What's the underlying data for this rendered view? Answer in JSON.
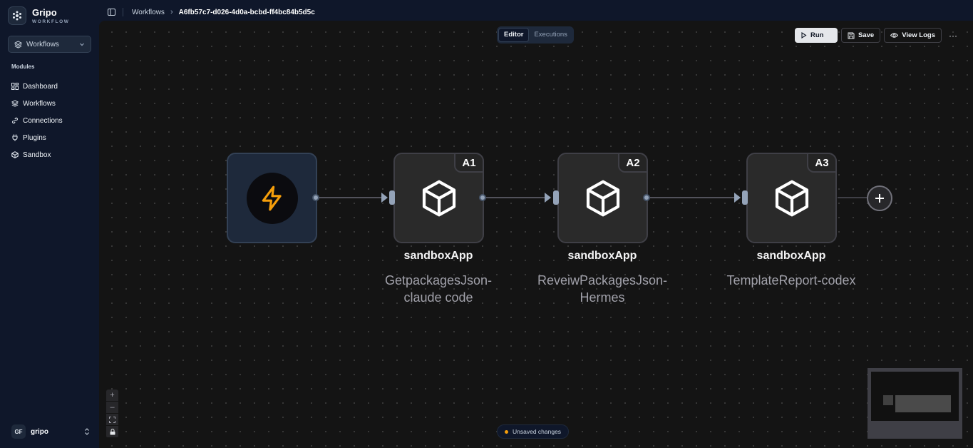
{
  "app": {
    "name": "Gripo",
    "subtitle": "WORKFLOW"
  },
  "workspace_select": {
    "label": "Workflows"
  },
  "sidebar": {
    "section_title": "Modules",
    "items": [
      {
        "label": "Dashboard",
        "icon": "dashboard-icon"
      },
      {
        "label": "Workflows",
        "icon": "layers-icon"
      },
      {
        "label": "Connections",
        "icon": "link-icon"
      },
      {
        "label": "Plugins",
        "icon": "plug-icon"
      },
      {
        "label": "Sandbox",
        "icon": "box-icon"
      }
    ]
  },
  "user": {
    "initials": "GF",
    "name": "gripo"
  },
  "breadcrumb": {
    "parent": "Workflows",
    "current": "A6fb57c7-d026-4d0a-bcbd-ff4bc84b5d5c"
  },
  "tabs": [
    {
      "label": "Editor",
      "active": true
    },
    {
      "label": "Executions",
      "active": false
    }
  ],
  "toolbar": {
    "run_label": "Run",
    "save_label": "Save",
    "logs_label": "View Logs",
    "more_label": "···"
  },
  "nodes": [
    {
      "badge": "A1",
      "title": "sandboxApp",
      "subtitle_line1": "GetpackagesJson-",
      "subtitle_line2": "claude code"
    },
    {
      "badge": "A2",
      "title": "sandboxApp",
      "subtitle_line1": "ReveiwPackagesJson-",
      "subtitle_line2": "Hermes"
    },
    {
      "badge": "A3",
      "title": "sandboxApp",
      "subtitle_line1": "TemplateReport-codex",
      "subtitle_line2": ""
    }
  ],
  "status": {
    "text": "Unsaved changes",
    "color": "#f59e0b"
  },
  "zoom_controls": {
    "zoom_in": "+",
    "zoom_out": "–"
  }
}
